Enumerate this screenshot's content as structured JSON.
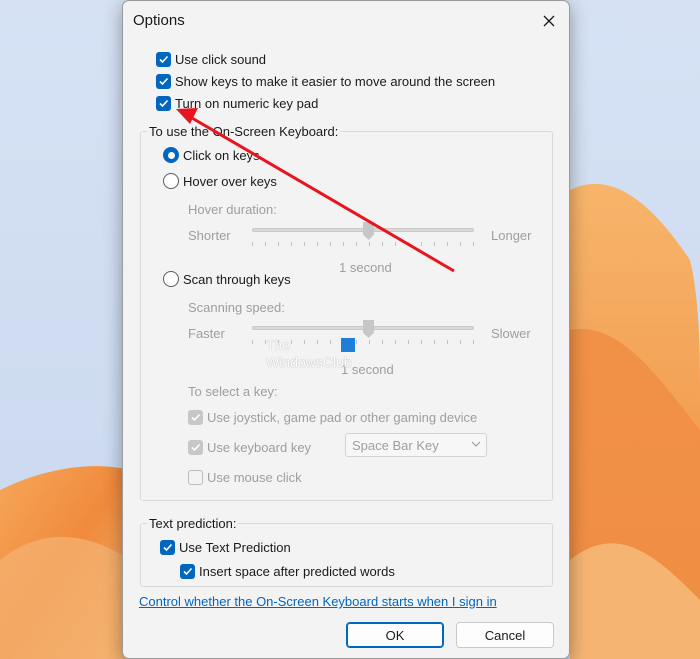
{
  "window": {
    "title": "Options",
    "close_icon": "close-icon"
  },
  "top_options": [
    {
      "label": "Use click sound",
      "checked": true
    },
    {
      "label": "Show keys to make it easier to move around the screen",
      "checked": true
    },
    {
      "label": "Turn on numeric key pad",
      "checked": true
    }
  ],
  "keyboard_group": {
    "title": "To use the On-Screen Keyboard:",
    "click_on_keys": {
      "label": "Click on keys",
      "selected": true
    },
    "hover_over_keys": {
      "label": "Hover over keys",
      "selected": false,
      "duration_label": "Hover duration:",
      "min_label": "Shorter",
      "max_label": "Longer",
      "value_label": "1 second"
    },
    "scan_through_keys": {
      "label": "Scan through keys",
      "selected": false,
      "speed_label": "Scanning speed:",
      "min_label": "Faster",
      "max_label": "Slower",
      "value_label": "1 second"
    },
    "select_key_label": "To select a key:",
    "use_joystick": {
      "label": "Use joystick, game pad or other gaming device",
      "checked": true,
      "disabled": true
    },
    "use_keyboard_key": {
      "label": "Use keyboard key",
      "checked": true,
      "disabled": true,
      "key_value": "Space Bar Key"
    },
    "use_mouse_click": {
      "label": "Use mouse click",
      "checked": false,
      "disabled": true
    }
  },
  "text_prediction": {
    "title": "Text prediction:",
    "use_text_prediction": {
      "label": "Use Text Prediction",
      "checked": true
    },
    "insert_space": {
      "label": "Insert space after predicted words",
      "checked": true
    }
  },
  "link_text": "Control whether the On-Screen Keyboard starts when I sign in",
  "buttons": {
    "ok": "OK",
    "cancel": "Cancel"
  },
  "watermark": {
    "line1": "The",
    "line2": "WindowsClub"
  },
  "colors": {
    "accent": "#0067c0",
    "annotation_arrow": "#e8141e"
  }
}
